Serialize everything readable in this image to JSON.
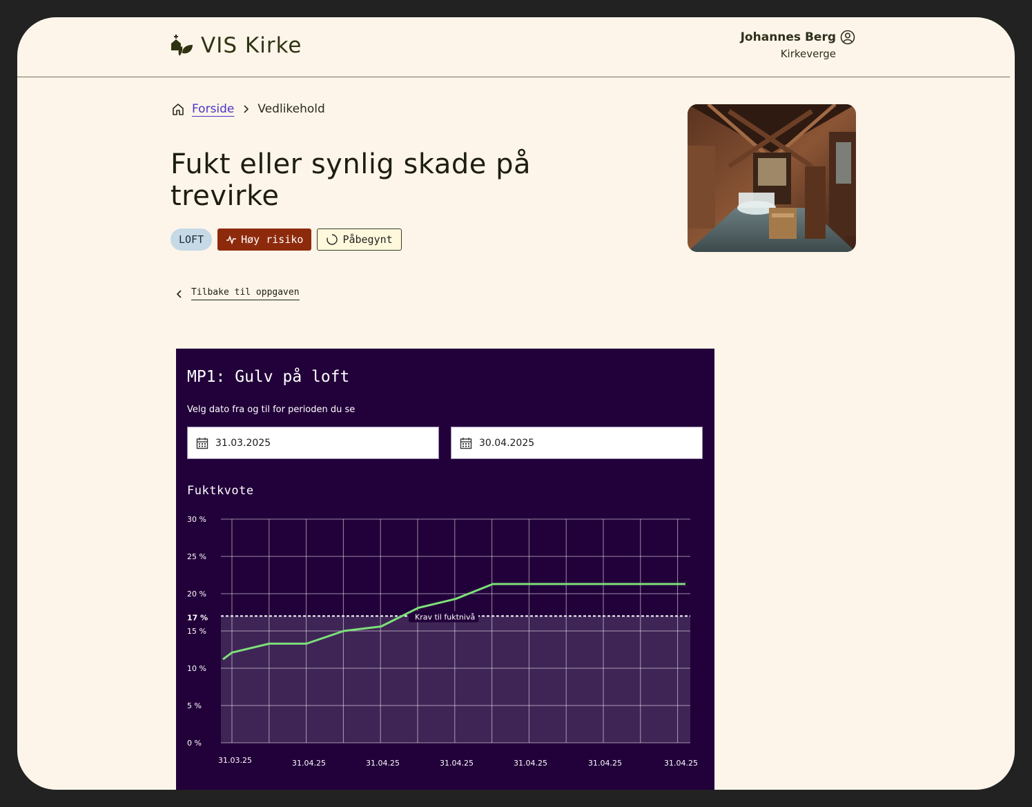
{
  "app": {
    "name": "VIS Kirke"
  },
  "user": {
    "name": "Johannes Berg",
    "role": "Kirkeverge"
  },
  "breadcrumb": {
    "home": "Forside",
    "current": "Vedlikehold"
  },
  "page": {
    "title": "Fukt eller synlig skade på trevirke"
  },
  "tags": {
    "location": "LOFT",
    "risk": "Høy risiko",
    "status": "Påbegynt"
  },
  "back": {
    "label": "Tilbake til oppgaven"
  },
  "card": {
    "title": "MP1: Gulv på loft",
    "date_prompt": "Velg dato fra og til for perioden du se",
    "date_from": "31.03.2025",
    "date_to": "30.04.2025"
  },
  "colors": {
    "card_bg": "#22003a",
    "line": "#7de07a",
    "risk": "#8e2a0c",
    "link": "#4c32c8"
  },
  "chart_data": {
    "type": "line",
    "title": "Fuktkvote",
    "ylabel": "",
    "xlabel": "",
    "ylim": [
      0,
      30
    ],
    "y_ticks": [
      "0 %",
      "5 %",
      "10 %",
      "15 %",
      "20 %",
      "25 %",
      "30 %"
    ],
    "y_tick_values": [
      0,
      5,
      10,
      15,
      20,
      25,
      30
    ],
    "x_tick_labels": [
      "31.03.25",
      "31.04.25",
      "31.04.25",
      "31.04.25",
      "31.04.25",
      "31.04.25",
      "31.04.25"
    ],
    "x": [
      0,
      1,
      2,
      3,
      4,
      5,
      6,
      7,
      8,
      9,
      10,
      11,
      12
    ],
    "grid": true,
    "series": [
      {
        "values": [
          11.2,
          12.1,
          13.3,
          13.3,
          15.0,
          15.6,
          18.1,
          19.3,
          21.3,
          21.3,
          21.3,
          21.3,
          21.3,
          21.3
        ]
      }
    ],
    "threshold": {
      "value": 17,
      "label": "Krav til fuktnivå",
      "tick_label": "17 %"
    }
  }
}
